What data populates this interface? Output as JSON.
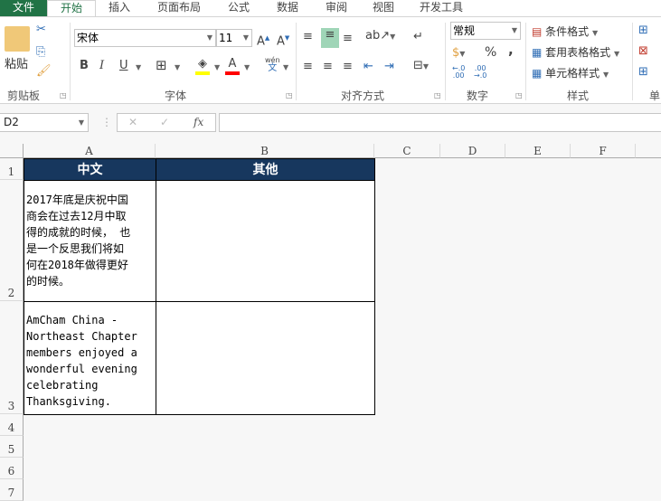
{
  "tabs": [
    "文件",
    "开始",
    "插入",
    "页面布局",
    "公式",
    "数据",
    "审阅",
    "视图",
    "开发工具"
  ],
  "ribbon": {
    "clipboard": {
      "paste": "粘贴",
      "label": "剪贴板"
    },
    "font": {
      "name": "宋体",
      "size": "11",
      "label": "字体",
      "bold": "B",
      "italic": "I",
      "underline": "U",
      "phonetic": "wén",
      "phonetic_char": "文"
    },
    "alignment": {
      "label": "对齐方式"
    },
    "number": {
      "format": "常规",
      "label": "数字",
      "percent": "%",
      "comma": ","
    },
    "styles": {
      "conditional": "条件格式",
      "table": "套用表格格式",
      "cell": "单元格样式",
      "label": "样式"
    },
    "cells": {
      "label": "单"
    }
  },
  "colors": {
    "file_tab": "#217346",
    "header_fill": "#17375e",
    "fill_color": "#ffff00",
    "font_color": "#ff0000"
  },
  "formula_bar": {
    "name_box": "D2",
    "cancel": "✕",
    "enter": "✓",
    "fx": "fx",
    "value": ""
  },
  "columns": [
    "A",
    "B",
    "C",
    "D",
    "E",
    "F"
  ],
  "rows": [
    "1",
    "2",
    "3",
    "4",
    "5",
    "6",
    "7"
  ],
  "cells": {
    "A1": "中文",
    "B1": "其他",
    "A2": [
      "2017年底是庆祝中国",
      "商会在过去12月中取",
      "得的成就的时候， 也",
      "是一个反思我们将如",
      "何在2018年做得更好",
      "的时候。"
    ],
    "A3": [
      "AmCham China -",
      "Northeast Chapter",
      "members enjoyed a",
      "wonderful evening",
      "celebrating",
      "Thanksgiving."
    ],
    "B2": "",
    "B3": ""
  }
}
